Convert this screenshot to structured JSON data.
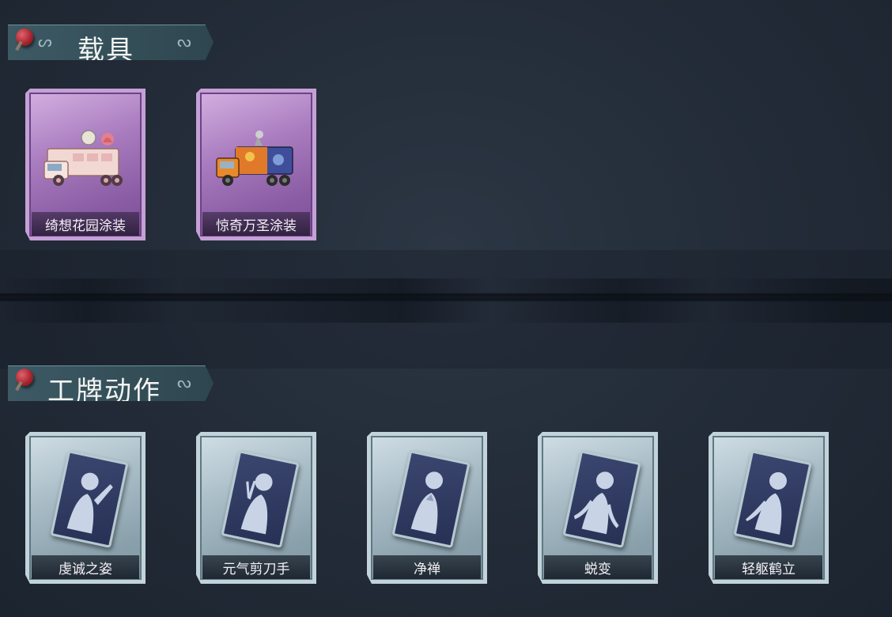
{
  "sections": {
    "vehicles": {
      "title": "载具",
      "items": [
        {
          "label": "绮想花园涂装",
          "icon": "vehicle-garden-skin-icon"
        },
        {
          "label": "惊奇万圣涂装",
          "icon": "vehicle-halloween-skin-icon"
        }
      ]
    },
    "badge_actions": {
      "title": "工牌动作",
      "items": [
        {
          "label": "虔诚之姿",
          "icon": "pose-wave-icon"
        },
        {
          "label": "元气剪刀手",
          "icon": "pose-peace-sign-icon"
        },
        {
          "label": "净禅",
          "icon": "pose-zen-icon"
        },
        {
          "label": "蜕变",
          "icon": "pose-transform-icon"
        },
        {
          "label": "轻躯鹤立",
          "icon": "pose-crane-icon"
        }
      ]
    }
  },
  "colors": {
    "background": "#242d39",
    "header": "#3d5a64",
    "vehicle_card": "#a97cbf",
    "emote_card": "#a8bcc6",
    "pin": "#a5222d"
  }
}
